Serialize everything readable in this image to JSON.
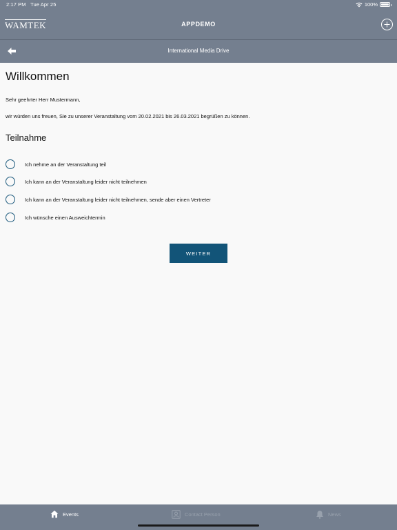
{
  "status_bar": {
    "time": "2:17 PM",
    "date": "Tue Apr 25",
    "battery": "100%",
    "battery_level": 1.0
  },
  "header": {
    "brand": "WAMTEK",
    "title": "APPDEMO"
  },
  "subheader": {
    "title": "International Media Drive"
  },
  "main": {
    "title": "Willkommen",
    "greeting": "Sehr geehrter Herr Mustermann,",
    "intro": "wir würden uns freuen, Sie zu unserer Veranstaltung vom 20.02.2021 bis 26.03.2021 begrüßen zu können.",
    "section_title": "Teilnahme",
    "options": [
      {
        "label": "Ich nehme an der Veranstaltung teil"
      },
      {
        "label": "Ich kann an der Veranstaltung leider nicht teilnehmen"
      },
      {
        "label": "Ich kann an der Veranstaltung leider nicht teilnehmen, sende aber einen Vertreter"
      },
      {
        "label": "Ich wünsche einen Ausweichtermin"
      }
    ],
    "continue_label": "WEITER"
  },
  "tabbar": {
    "items": [
      {
        "label": "Events",
        "icon": "home-icon",
        "active": true
      },
      {
        "label": "Contact Person",
        "icon": "contact-card-icon",
        "active": false
      },
      {
        "label": "News",
        "icon": "bell-icon",
        "active": false
      }
    ]
  },
  "colors": {
    "bar": "#747f8f",
    "accent": "#125478",
    "radio_border": "#1e5b7e",
    "background": "#f9f9f9",
    "tab_inactive": "#98a1ad"
  }
}
